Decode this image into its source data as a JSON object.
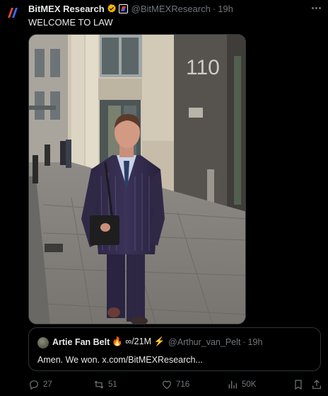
{
  "post": {
    "author_name": "BitMEX Research",
    "handle": "@BitMEXResearch",
    "separator": "·",
    "time": "19h",
    "text": "WELCOME TO LAW",
    "building_number": "110",
    "icons": [
      "bitmex-logo-icon",
      "verified-badge-icon",
      "affiliate-badge-icon",
      "more-icon"
    ]
  },
  "quote": {
    "author_name": "Artie Fan Belt",
    "name_emoji": "🔥 ∞/21M ⚡",
    "handle": "@Arthur_van_Pelt",
    "separator": "·",
    "time": "19h",
    "text": "Amen. We won. x.com/BitMEXResearch..."
  },
  "actions": {
    "replies": "27",
    "reposts": "51",
    "likes": "716",
    "views": "50K"
  },
  "colors": {
    "background": "#000000",
    "text_primary": "#e7e9ea",
    "text_secondary": "#71767b",
    "border": "#2f3336",
    "verified": "#f5b400"
  }
}
